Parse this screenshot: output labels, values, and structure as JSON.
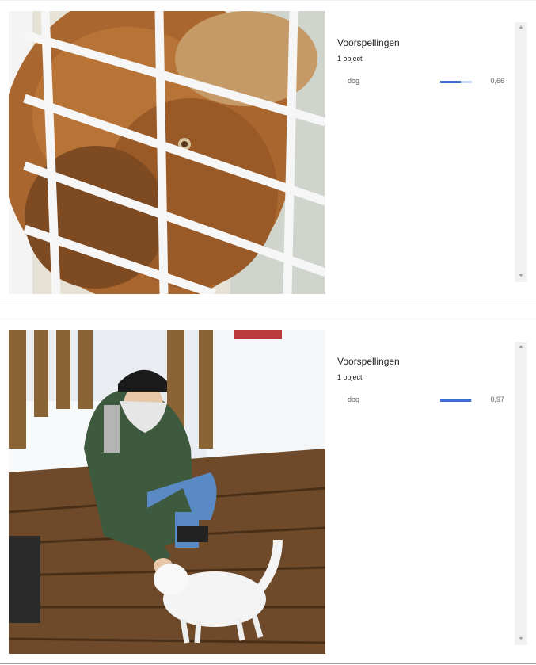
{
  "cards": [
    {
      "image": "dog-behind-fence",
      "panel_title": "Voorspellingen",
      "object_count": "1 object",
      "predictions": [
        {
          "label": "dog",
          "score": "0,66",
          "fraction": 0.66
        }
      ],
      "scroll_up": "▲",
      "scroll_down": "▼"
    },
    {
      "image": "man-petting-white-cat-on-deck",
      "panel_title": "Voorspellingen",
      "object_count": "1 object",
      "predictions": [
        {
          "label": "dog",
          "score": "0,97",
          "fraction": 0.97
        }
      ],
      "scroll_up": "▲",
      "scroll_down": "▼"
    }
  ],
  "colors": {
    "bar_fill": "#3c6fd1",
    "bar_track": "#c6dafc",
    "scroll_track": "#f1f1f1"
  }
}
